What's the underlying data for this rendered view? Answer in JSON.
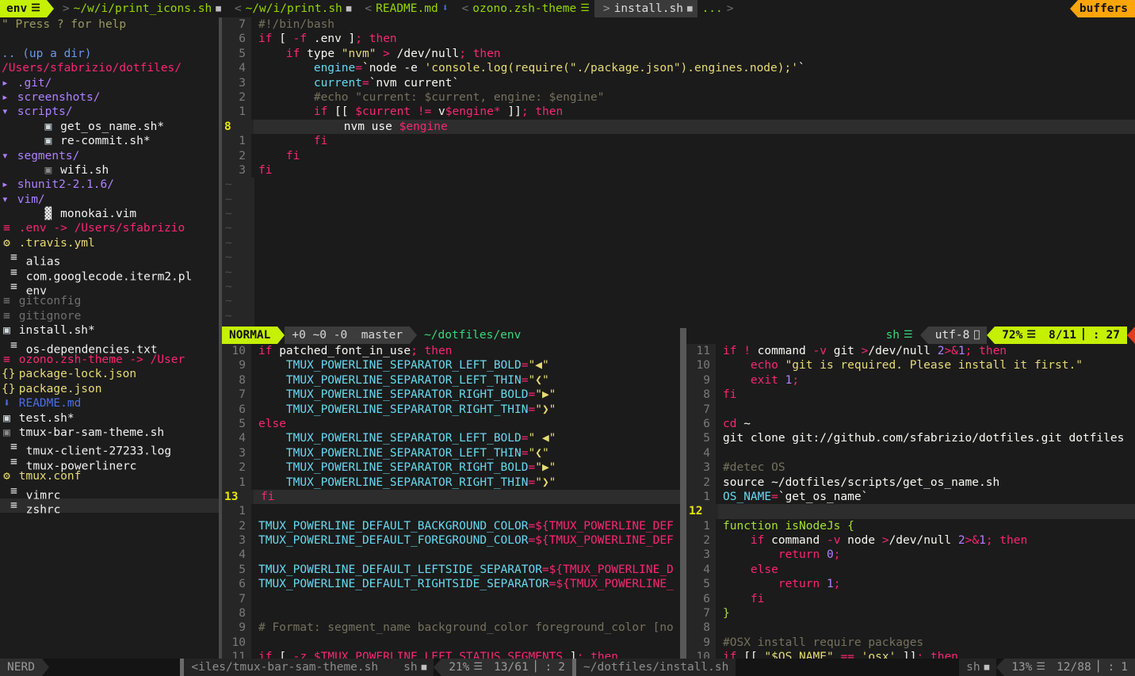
{
  "tabline": {
    "active_tab": {
      "label": "env",
      "icon": "text-file-icon"
    },
    "tabs": [
      {
        "label": "~/w/i/print_icons.sh",
        "prefix": ">",
        "icon": "modified-icon",
        "state": "inactive"
      },
      {
        "label": "~/w/i/print.sh",
        "prefix": "<",
        "icon": "modified-icon",
        "state": "inactive"
      },
      {
        "label": "README.md",
        "prefix": "<",
        "icon": "markdown-icon",
        "state": "inactive"
      },
      {
        "label": "ozono.zsh-theme",
        "prefix": "<",
        "icon": "text-file-icon",
        "state": "inactive"
      },
      {
        "label": "install.sh",
        "prefix": ">",
        "icon": "modified-icon",
        "state": "current"
      },
      {
        "label": "...",
        "prefix": "",
        "icon": "",
        "state": "overflow"
      }
    ],
    "right_label": "buffers",
    "accent_active": "#c5f000",
    "accent_buffers": "#ffa50a"
  },
  "nerdtree": {
    "help_hint": "\" Press ? for help",
    "up_dir": ".. (up a dir)",
    "root": "/Users/sfabrizio/dotfiles/",
    "entries": [
      {
        "name": ".git/",
        "type": "dir",
        "state": "closed",
        "indent": 0,
        "icon": "chevron-right-icon"
      },
      {
        "name": "screenshots/",
        "type": "dir",
        "state": "closed",
        "indent": 0,
        "icon": "chevron-right-icon"
      },
      {
        "name": "scripts/",
        "type": "dir",
        "state": "open",
        "indent": 0,
        "icon": "chevron-down-icon"
      },
      {
        "name": "get_os_name.sh*",
        "type": "sh",
        "indent": 1,
        "icon": "shell-script-icon"
      },
      {
        "name": "re-commit.sh*",
        "type": "sh",
        "indent": 1,
        "icon": "shell-script-icon"
      },
      {
        "name": "segments/",
        "type": "dir",
        "state": "open",
        "indent": 0,
        "icon": "chevron-down-icon"
      },
      {
        "name": "wifi.sh",
        "type": "shdim",
        "indent": 1,
        "icon": "shell-script-icon"
      },
      {
        "name": "shunit2-2.1.6/",
        "type": "dir",
        "state": "closed",
        "indent": 0,
        "icon": "chevron-right-icon"
      },
      {
        "name": "vim/",
        "type": "dir",
        "state": "open",
        "indent": 0,
        "icon": "chevron-down-icon"
      },
      {
        "name": "monokai.vim",
        "type": "vim",
        "indent": 1,
        "icon": "vim-icon"
      },
      {
        "name": ".env -> /Users/sfabrizio",
        "type": "link",
        "indent": 0,
        "icon": "text-file-icon"
      },
      {
        "name": ".travis.yml",
        "type": "yaml",
        "indent": 0,
        "icon": "gear-icon"
      },
      {
        "name": "alias",
        "type": "file",
        "indent": 0,
        "icon": "text-file-icon"
      },
      {
        "name": "com.googlecode.iterm2.pl",
        "type": "file",
        "indent": 0,
        "icon": "text-file-icon"
      },
      {
        "name": "env",
        "type": "file",
        "indent": 0,
        "icon": "text-file-icon"
      },
      {
        "name": "gitconfig",
        "type": "dim",
        "indent": 0,
        "icon": "text-file-icon"
      },
      {
        "name": "gitignore",
        "type": "dim",
        "indent": 0,
        "icon": "text-file-icon"
      },
      {
        "name": "install.sh*",
        "type": "sh",
        "indent": 0,
        "icon": "shell-script-icon"
      },
      {
        "name": "os-dependencies.txt",
        "type": "file",
        "indent": 0,
        "icon": "text-file-icon"
      },
      {
        "name": "ozono.zsh-theme -> /User",
        "type": "link",
        "indent": 0,
        "icon": "text-file-icon"
      },
      {
        "name": "package-lock.json",
        "type": "json",
        "indent": 0,
        "icon": "json-icon"
      },
      {
        "name": "package.json",
        "type": "json",
        "indent": 0,
        "icon": "json-icon"
      },
      {
        "name": "README.md",
        "type": "md",
        "indent": 0,
        "icon": "markdown-icon"
      },
      {
        "name": "test.sh*",
        "type": "sh",
        "indent": 0,
        "icon": "shell-script-icon"
      },
      {
        "name": "tmux-bar-sam-theme.sh",
        "type": "shdim",
        "indent": 0,
        "icon": "shell-script-icon"
      },
      {
        "name": "tmux-client-27233.log",
        "type": "file",
        "indent": 0,
        "icon": "text-file-icon"
      },
      {
        "name": "tmux-powerlinerc",
        "type": "file",
        "indent": 0,
        "icon": "text-file-icon"
      },
      {
        "name": "tmux.conf",
        "type": "yaml",
        "indent": 0,
        "icon": "gear-icon"
      },
      {
        "name": "vimrc",
        "type": "file",
        "indent": 0,
        "icon": "text-file-icon"
      },
      {
        "name": "zshrc",
        "type": "file",
        "indent": 0,
        "icon": "text-file-icon",
        "selected": true
      }
    ],
    "statusline": {
      "label": "NERD"
    }
  },
  "pane_top": {
    "lines": [
      {
        "num": "7",
        "html": "<span class='cm'>#!/bin/bash</span>"
      },
      {
        "num": "6",
        "html": "<span class='k'>if</span> <span class='w'>[</span> <span class='k'>-f</span> <span class='w'>.env</span> <span class='w'>]</span><span class='k'>;</span> <span class='k'>then</span>"
      },
      {
        "num": "5",
        "html": "    <span class='k'>if</span> <span class='w'>type</span> <span class='s'>\"nvm\"</span> <span class='k'>&gt;</span> <span class='w'>/dev/null</span><span class='k'>;</span> <span class='k'>then</span>"
      },
      {
        "num": "4",
        "html": "        <span class='v'>engine</span><span class='k'>=</span><span class='w'>`node -e </span><span class='s'>'console.log(require(\"./package.json\").engines.node);'</span><span class='w'>`</span>"
      },
      {
        "num": "3",
        "html": "        <span class='v'>current</span><span class='k'>=</span><span class='w'>`nvm current`</span>"
      },
      {
        "num": "2",
        "html": "        <span class='cm'>#echo \"current: $current, engine: $engine\"</span>"
      },
      {
        "num": "1",
        "html": "        <span class='k'>if</span> <span class='w'>[[</span> <span class='k'>$current</span> <span class='k'>!=</span> <span class='w'>v</span><span class='k'>$engine</span><span class='k'>*</span> <span class='w'>]]</span><span class='k'>;</span> <span class='k'>then</span>"
      },
      {
        "num": "8",
        "cur": true,
        "html": "            <span class='w'>nvm use </span><span class='k'>$engine</span>"
      },
      {
        "num": "1",
        "html": "        <span class='k'>fi</span>"
      },
      {
        "num": "2",
        "html": "    <span class='k'>fi</span>"
      },
      {
        "num": "3",
        "html": "<span class='k'>fi</span>"
      }
    ],
    "filler": "~",
    "filler_count": 11
  },
  "status_main": {
    "mode": "NORMAL",
    "git": "+0 ~0 -0  master",
    "git_branch_icon": "git-branch-icon",
    "file": "~/dotfiles/env",
    "filetype": "sh",
    "filetype_icon": "text-lines-icon",
    "encoding": "utf-8",
    "os_icon": "apple-icon",
    "percent": "72%",
    "percent_icon": "lines-icon",
    "position": "8/11",
    "col_icon": "column-icon",
    "column": "27"
  },
  "pane_bottom_left": {
    "lines": [
      {
        "num": "10",
        "html": "<span class='k'>if</span> <span class='w'>patched_font_in_use</span><span class='k'>;</span> <span class='k'>then</span>"
      },
      {
        "num": "9",
        "html": "    <span class='v'>TMUX_POWERLINE_SEPARATOR_LEFT_BOLD</span><span class='k'>=</span><span class='s'>\"</span><span class='sep-glyph'>◀</span><span class='s'>\"</span>"
      },
      {
        "num": "8",
        "html": "    <span class='v'>TMUX_POWERLINE_SEPARATOR_LEFT_THIN</span><span class='k'>=</span><span class='s'>\"</span><span class='sep-glyph'>❮</span><span class='s'>\"</span>"
      },
      {
        "num": "7",
        "html": "    <span class='v'>TMUX_POWERLINE_SEPARATOR_RIGHT_BOLD</span><span class='k'>=</span><span class='s'>\"</span><span class='sep-glyph'>▶</span><span class='s'>\"</span>"
      },
      {
        "num": "6",
        "html": "    <span class='v'>TMUX_POWERLINE_SEPARATOR_RIGHT_THIN</span><span class='k'>=</span><span class='s'>\"</span><span class='sep-glyph'>❯</span><span class='s'>\"</span>"
      },
      {
        "num": "5",
        "html": "<span class='k'>else</span>"
      },
      {
        "num": "4",
        "html": "    <span class='v'>TMUX_POWERLINE_SEPARATOR_LEFT_BOLD</span><span class='k'>=</span><span class='s'>\" </span><span class='sep-glyph'>◀</span><span class='s'>\"</span>"
      },
      {
        "num": "3",
        "html": "    <span class='v'>TMUX_POWERLINE_SEPARATOR_LEFT_THIN</span><span class='k'>=</span><span class='s'>\"</span><span class='sep-glyph'>❮</span><span class='s'>\"</span>"
      },
      {
        "num": "2",
        "html": "    <span class='v'>TMUX_POWERLINE_SEPARATOR_RIGHT_BOLD</span><span class='k'>=</span><span class='s'>\"</span><span class='sep-glyph'>▶</span><span class='s'>\"</span>"
      },
      {
        "num": "1",
        "html": "    <span class='v'>TMUX_POWERLINE_SEPARATOR_RIGHT_THIN</span><span class='k'>=</span><span class='s'>\"</span><span class='sep-glyph'>❯</span><span class='s'>\"</span>"
      },
      {
        "num": "13",
        "cur": true,
        "html": "<span class='k'>fi</span>"
      },
      {
        "num": "1",
        "html": ""
      },
      {
        "num": "2",
        "html": "<span class='v'>TMUX_POWERLINE_DEFAULT_BACKGROUND_COLOR</span><span class='k'>=${TMUX_POWERLINE_DEF</span>"
      },
      {
        "num": "3",
        "html": "<span class='v'>TMUX_POWERLINE_DEFAULT_FOREGROUND_COLOR</span><span class='k'>=${TMUX_POWERLINE_DEF</span>"
      },
      {
        "num": "4",
        "html": ""
      },
      {
        "num": "5",
        "html": "<span class='v'>TMUX_POWERLINE_DEFAULT_LEFTSIDE_SEPARATOR</span><span class='k'>=${TMUX_POWERLINE_D</span>"
      },
      {
        "num": "6",
        "html": "<span class='v'>TMUX_POWERLINE_DEFAULT_RIGHTSIDE_SEPARATOR</span><span class='k'>=${TMUX_POWERLINE_</span>"
      },
      {
        "num": "7",
        "html": ""
      },
      {
        "num": "8",
        "html": ""
      },
      {
        "num": "9",
        "html": "<span class='cm'># Format: segment_name background_color foreground_color [no</span>"
      },
      {
        "num": "10",
        "html": ""
      },
      {
        "num": "11",
        "html": "<span class='k'>if</span> <span class='w'>[</span> <span class='k'>-z</span> <span class='k'>$TMUX_POWERLINE_LEFT_STATUS_SEGMENTS</span> <span class='w'>]</span><span class='k'>;</span> <span class='k'>then</span>"
      }
    ]
  },
  "status_bottom_left": {
    "mode": "NERD",
    "file": "<iles/tmux-bar-sam-theme.sh",
    "filetype": "sh",
    "filetype_icon": "modified-icon",
    "percent": "21%",
    "percent_icon": "lines-icon",
    "position": "13/61",
    "col_icon": "column-icon",
    "column": "2"
  },
  "pane_bottom_right": {
    "lines": [
      {
        "num": "11",
        "html": "<span class='k'>if</span> <span class='k'>!</span> <span class='w'>command</span> <span class='k'>-v</span> <span class='w'>git</span> <span class='k'>&gt;</span><span class='w'>/dev/null</span> <span class='n'>2</span><span class='k'>&gt;&amp;</span><span class='n'>1</span><span class='k'>;</span> <span class='k'>then</span>"
      },
      {
        "num": "10",
        "html": "    <span class='k'>echo</span> <span class='s'>\"git is required. Please install it first.\"</span>"
      },
      {
        "num": "9",
        "html": "    <span class='k'>exit</span> <span class='n'>1</span><span class='k'>;</span>"
      },
      {
        "num": "8",
        "html": "<span class='k'>fi</span>"
      },
      {
        "num": "7",
        "html": ""
      },
      {
        "num": "6",
        "html": "<span class='k'>cd</span> <span class='w'>~</span>"
      },
      {
        "num": "5",
        "html": "<span class='w'>git clone git://github.com/sfabrizio/dotfiles.git dotfiles</span>"
      },
      {
        "num": "4",
        "html": ""
      },
      {
        "num": "3",
        "html": "<span class='cm'>#detec OS</span>"
      },
      {
        "num": "2",
        "html": "<span class='w'>source ~/dotfiles/scripts/get_os_name.sh</span>"
      },
      {
        "num": "1",
        "html": "<span class='v'>OS_NAME</span><span class='k'>=</span><span class='w'>`get_os_name`</span>"
      },
      {
        "num": "12",
        "cur": true,
        "html": ""
      },
      {
        "num": "1",
        "html": "<span class='fn'>function</span> <span class='fn'>isNodeJs</span> <span class='fn'>{</span>"
      },
      {
        "num": "2",
        "html": "    <span class='k'>if</span> <span class='w'>command</span> <span class='k'>-v</span> <span class='w'>node</span> <span class='k'>&gt;</span><span class='w'>/dev/null</span> <span class='n'>2</span><span class='k'>&gt;&amp;</span><span class='n'>1</span><span class='k'>;</span> <span class='k'>then</span>"
      },
      {
        "num": "3",
        "html": "        <span class='k'>return</span> <span class='n'>0</span><span class='k'>;</span>"
      },
      {
        "num": "4",
        "html": "    <span class='k'>else</span>"
      },
      {
        "num": "5",
        "html": "        <span class='k'>return</span> <span class='n'>1</span><span class='k'>;</span>"
      },
      {
        "num": "6",
        "html": "    <span class='k'>fi</span>"
      },
      {
        "num": "7",
        "html": "<span class='fn'>}</span>"
      },
      {
        "num": "8",
        "html": ""
      },
      {
        "num": "9",
        "html": "<span class='cm'>#OSX install require packages</span>"
      },
      {
        "num": "10",
        "html": "<span class='k'>if</span> <span class='w'>[[</span> <span class='s'>\"$OS_NAME\"</span> <span class='k'>==</span> <span class='s'>'osx'</span> <span class='w'>]]</span><span class='k'>;</span> <span class='k'>then</span>"
      }
    ]
  },
  "status_bottom_right": {
    "file": "~/dotfiles/install.sh",
    "filetype": "sh",
    "filetype_icon": "modified-icon",
    "percent": "13%",
    "percent_icon": "lines-icon",
    "position": "12/88",
    "col_icon": "column-icon",
    "column": "1"
  }
}
